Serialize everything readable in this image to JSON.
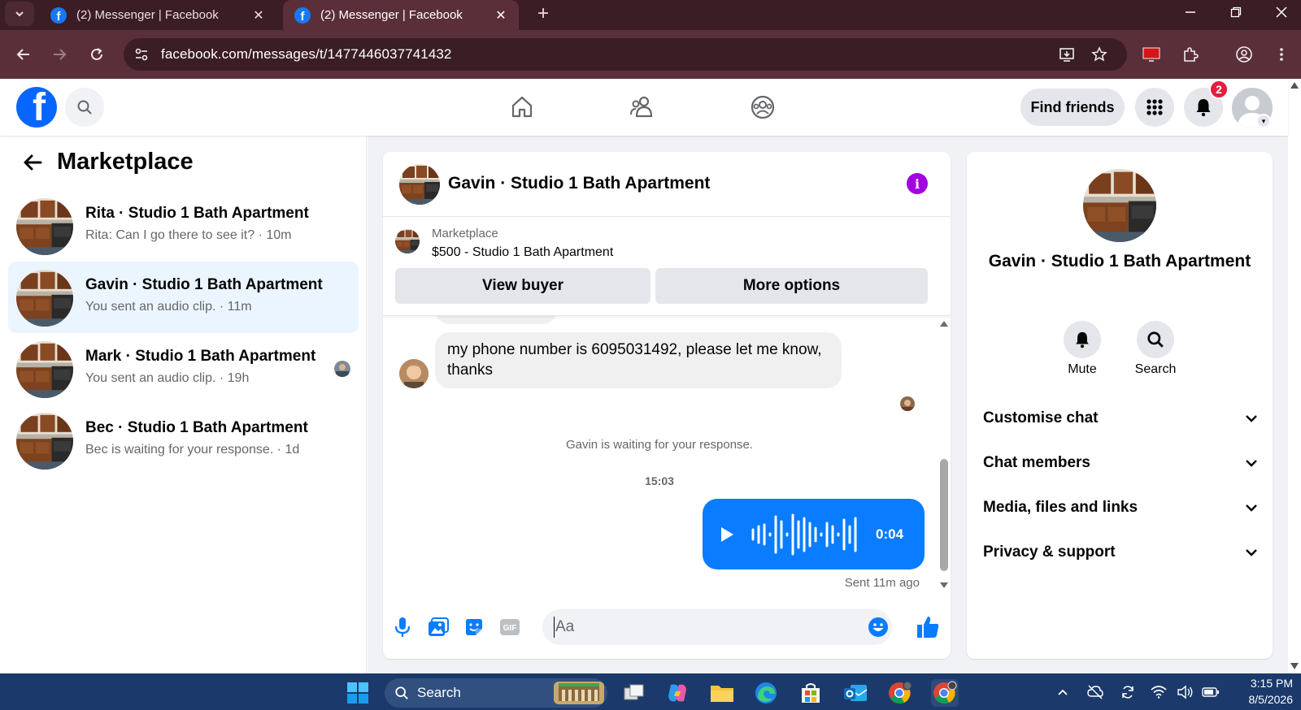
{
  "browser": {
    "tabs": [
      {
        "title": "(2) Messenger | Facebook",
        "active": false
      },
      {
        "title": "(2) Messenger | Facebook",
        "active": true
      }
    ],
    "url": "facebook.com/messages/t/1477446037741432"
  },
  "header": {
    "find_friends": "Find friends",
    "notification_count": "2"
  },
  "sidebar": {
    "title": "Marketplace",
    "conversations": [
      {
        "name": "Rita · Studio 1 Bath Apartment",
        "preview": "Rita: Can I go there to see it? · 10m",
        "active": false
      },
      {
        "name": "Gavin · Studio 1 Bath Apartment",
        "preview": "You sent an audio clip. · 11m",
        "active": true
      },
      {
        "name": "Mark · Studio 1 Bath Apartment",
        "preview": "You sent an audio clip. · 19h",
        "active": false
      },
      {
        "name": "Bec · Studio 1 Bath Apartment",
        "preview": "Bec is waiting for your response. · 1d",
        "active": false
      }
    ]
  },
  "chat": {
    "title": "Gavin · Studio 1 Bath Apartment",
    "listing": {
      "category": "Marketplace",
      "price_title": "$500 - Studio 1 Bath Apartment",
      "view_buyer": "View buyer",
      "more_options": "More options"
    },
    "messages": {
      "incoming_text": "my phone number is 6095031492, please let me know, thanks",
      "waiting_note": "Gavin is waiting for your response.",
      "timestamp": "15:03",
      "audio_duration": "0:04",
      "sent_status": "Sent 11m ago"
    },
    "composer": {
      "placeholder": "Aa"
    }
  },
  "info_panel": {
    "name": "Gavin · Studio 1 Bath Apartment",
    "actions": [
      {
        "label": "Mute",
        "icon": "bell-icon"
      },
      {
        "label": "Search",
        "icon": "search-icon"
      }
    ],
    "sections": [
      "Customise chat",
      "Chat members",
      "Media, files and links",
      "Privacy & support"
    ]
  },
  "taskbar": {
    "search_label": "Search",
    "time": "3:15 PM",
    "date": "8/5/2026"
  },
  "colors": {
    "brand_blue": "#0866ff",
    "messenger_blue": "#0a7cff",
    "info_purple": "#a200e0",
    "active_conversation": "#ebf5ff",
    "browser_frame": "#5b2f3a"
  }
}
